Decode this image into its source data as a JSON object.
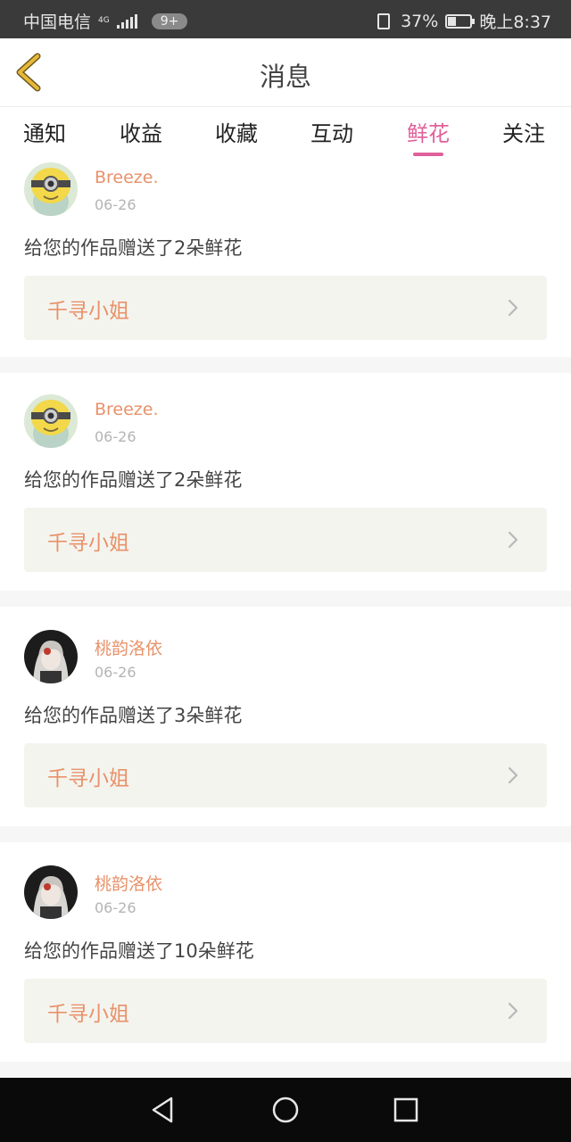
{
  "status_bar": {
    "carrier": "中国电信",
    "net_type": "4G",
    "notification_badge": "9+",
    "battery": "37%",
    "battery_level": 0.37,
    "time": "晚上8:37"
  },
  "header": {
    "title": "消息",
    "back_icon": "chevron-left-icon",
    "accent_color": "#e8b83a"
  },
  "tabs": [
    {
      "label": "通知"
    },
    {
      "label": "收益"
    },
    {
      "label": "收藏"
    },
    {
      "label": "互动"
    },
    {
      "label": "鲜花",
      "active": true
    },
    {
      "label": "关注"
    }
  ],
  "active_tab_color": "#e0609a",
  "messages": [
    {
      "user": "Breeze.",
      "date": "06-26",
      "text": "给您的作品赠送了2朵鲜花",
      "work": "千寻小姐",
      "avatar": "minion-avatar"
    },
    {
      "user": "Breeze.",
      "date": "06-26",
      "text": "给您的作品赠送了2朵鲜花",
      "work": "千寻小姐",
      "avatar": "minion-avatar"
    },
    {
      "user": "桃韵洛依",
      "date": "06-26",
      "text": "给您的作品赠送了3朵鲜花",
      "work": "千寻小姐",
      "avatar": "anime-girl-avatar"
    },
    {
      "user": "桃韵洛依",
      "date": "06-26",
      "text": "给您的作品赠送了10朵鲜花",
      "work": "千寻小姐",
      "avatar": "anime-girl-avatar"
    }
  ],
  "nav_bar": {
    "back": "triangle-back-icon",
    "home": "circle-home-icon",
    "recents": "square-recents-icon"
  }
}
